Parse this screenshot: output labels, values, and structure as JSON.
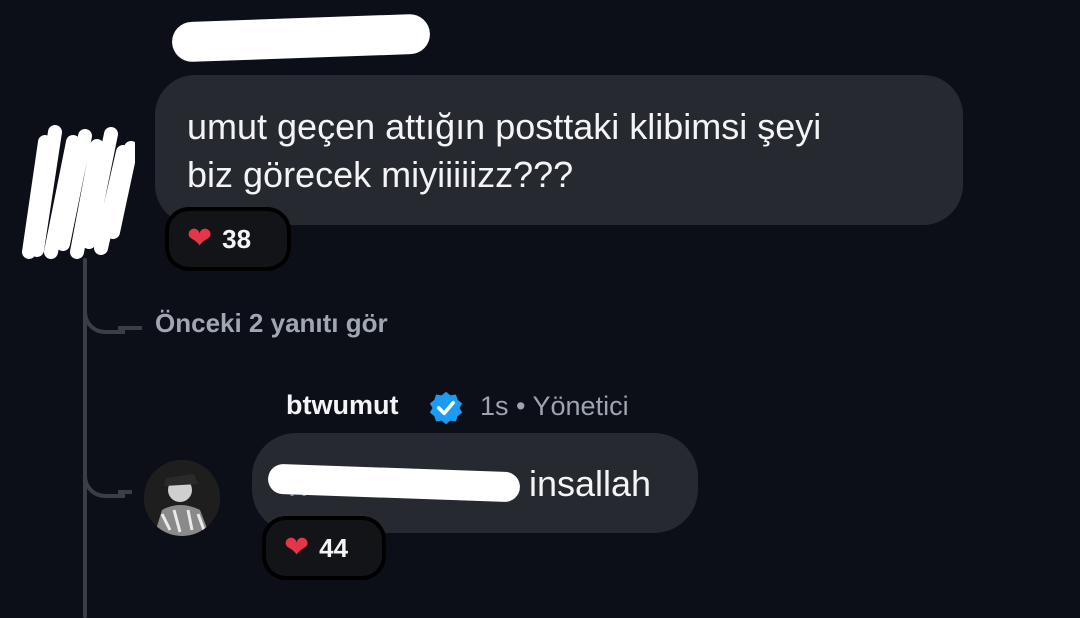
{
  "comment": {
    "text": "umut geçen attığın posttaki klibimsi şeyi\nbiz görecek miyiiiiizz???",
    "likes": "38"
  },
  "view_previous": "Önceki 2 yanıtı gör",
  "reply": {
    "username": "btwumut",
    "time": "1s",
    "separator": "•",
    "role": "Yönetici",
    "mention_visible": "rr",
    "text": "insallah",
    "likes": "44"
  },
  "icons": {
    "reaction": "heart-icon",
    "verified": "verified-badge-icon",
    "avatar": "avatar"
  },
  "colors": {
    "background": "#0c0f17",
    "bubble": "#26292f",
    "mention": "#5b8dd9",
    "verified": "#1d9bf0",
    "heart": "#e53548"
  }
}
